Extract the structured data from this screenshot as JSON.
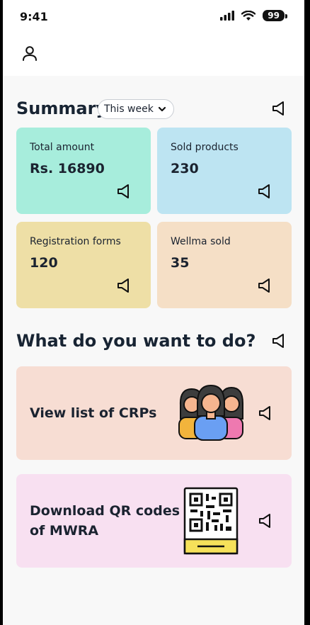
{
  "status_bar": {
    "time": "9:41",
    "battery": "99"
  },
  "summary": {
    "title": "Summary",
    "period": "This week",
    "stats": [
      {
        "label": "Total amount",
        "value": "Rs. 16890",
        "color": "#a7eddc"
      },
      {
        "label": "Sold products",
        "value": "230",
        "color": "#bde4f2"
      },
      {
        "label": "Registration forms",
        "value": "120",
        "color": "#eedfa6"
      },
      {
        "label": "Wellma sold",
        "value": "35",
        "color": "#f5dfc6"
      }
    ]
  },
  "actions": {
    "title": "What do you want to do?",
    "items": [
      {
        "label": "View list of CRPs",
        "color": "#f7ddd3",
        "icon": "women-group-icon"
      },
      {
        "label_line1": "Download QR codes",
        "label_line2": "of MWRA",
        "color": "#f8e0f1",
        "icon": "qr-code-icon"
      }
    ]
  },
  "colors": {
    "background": "#f8f8f8",
    "text": "#1b2330"
  }
}
